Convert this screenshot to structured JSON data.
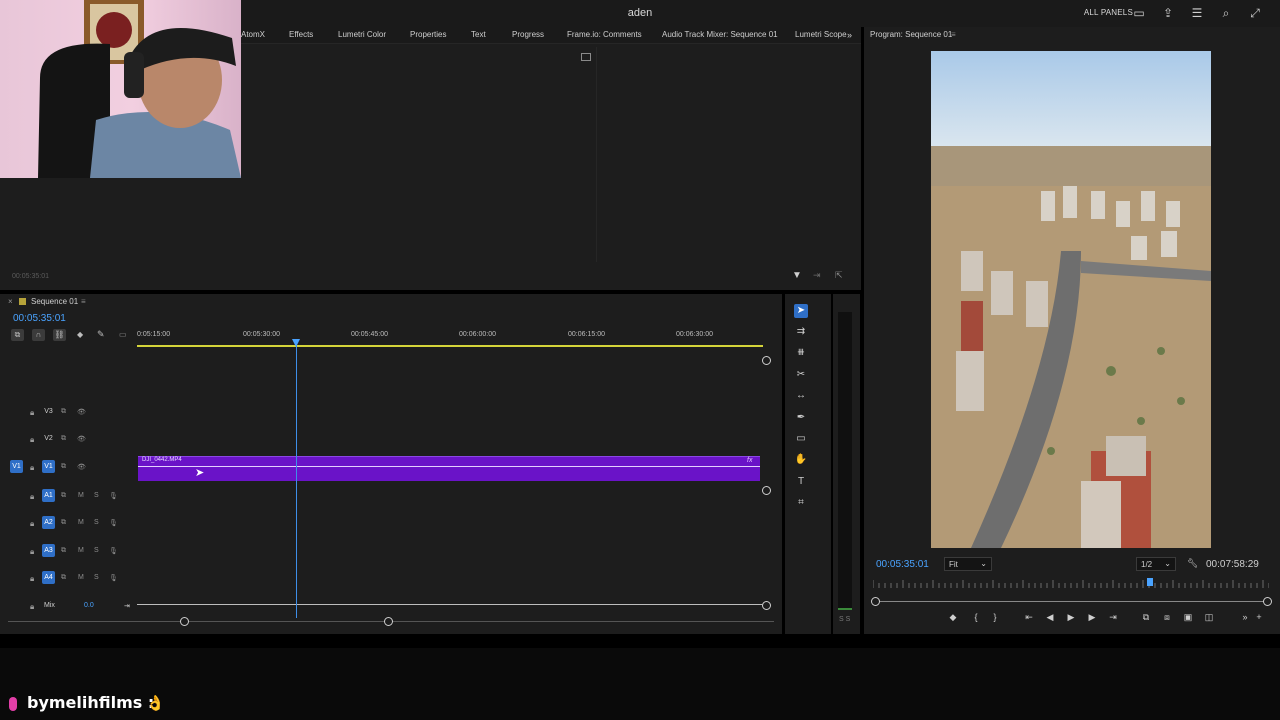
{
  "app": {
    "title": "aden"
  },
  "header": {
    "all_panels": "ALL PANELS"
  },
  "tabs": [
    {
      "label": "AtomX"
    },
    {
      "label": "Effects"
    },
    {
      "label": "Lumetri Color"
    },
    {
      "label": "Properties"
    },
    {
      "label": "Text"
    },
    {
      "label": "Progress"
    },
    {
      "label": "Frame.io: Comments"
    },
    {
      "label": "Audio Track Mixer: Sequence 01"
    },
    {
      "label": "Lumetri Scope"
    }
  ],
  "source": {
    "timecode": "00:05:35:01"
  },
  "timeline": {
    "sequence_name": "Sequence 01",
    "timecode": "00:05:35:01",
    "ruler": [
      "0:05:15:00",
      "00:05:30:00",
      "00:05:45:00",
      "00:06:00:00",
      "00:06:15:00",
      "00:06:30:00"
    ],
    "video_tracks": [
      "V3",
      "V2",
      "V1"
    ],
    "v1_target": "V1",
    "audio_tracks": [
      "A1",
      "A2",
      "A3",
      "A4"
    ],
    "track_m": "M",
    "track_s": "S",
    "mix_label": "Mix",
    "mix_value": "0.0",
    "clip": {
      "name": "DJI_0442.MP4",
      "fx": "fx"
    }
  },
  "meter": {
    "label": "S S"
  },
  "program": {
    "title": "Program: Sequence 01",
    "timecode": "00:05:35:01",
    "fit": "Fit",
    "resolution": "1/2",
    "duration": "00:07:58:29",
    "playhead_fraction": 0.7
  },
  "overlay": {
    "handle": "bymelihfilms :"
  }
}
